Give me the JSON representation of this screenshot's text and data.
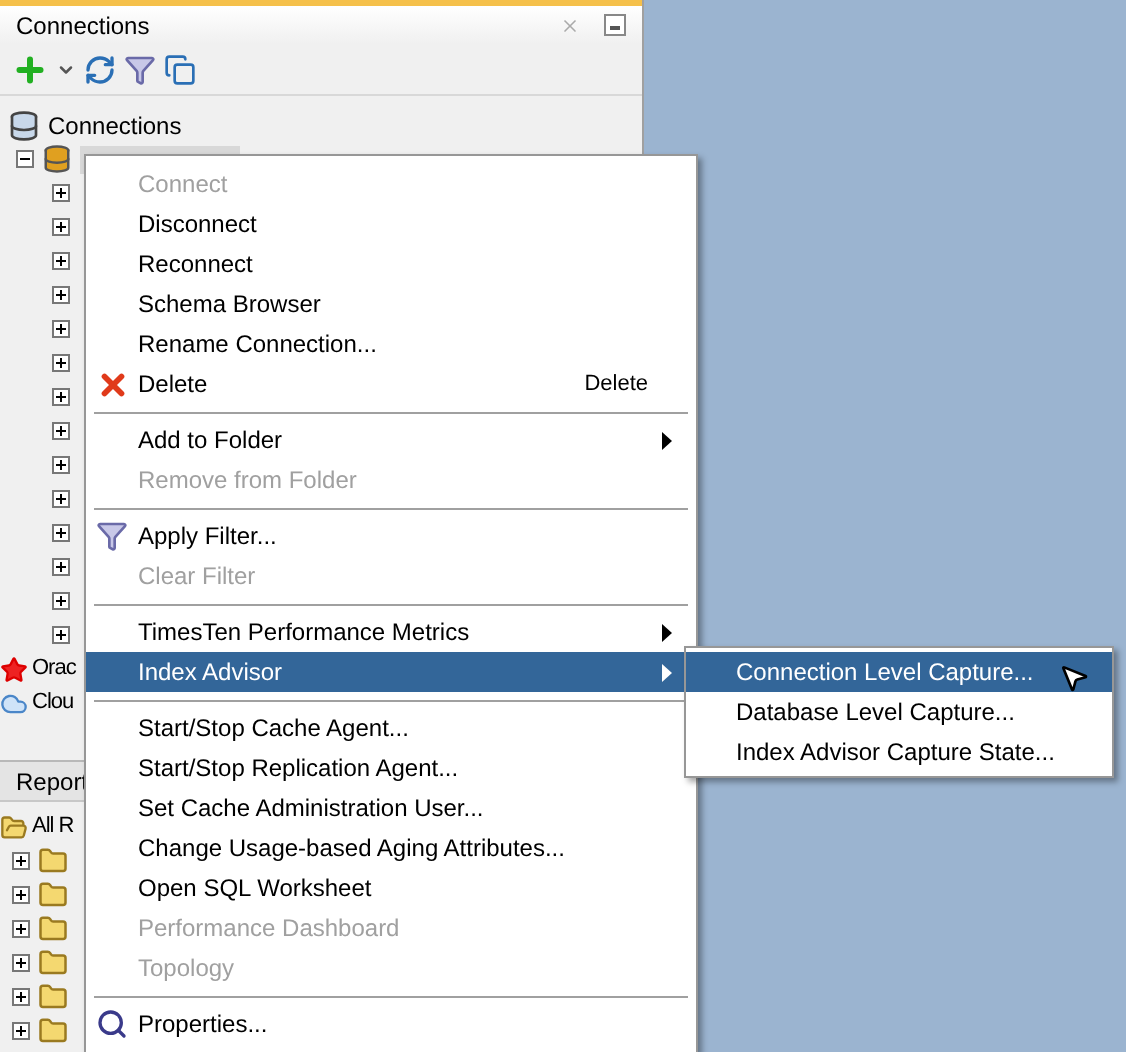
{
  "connections_panel": {
    "title": "Connections",
    "toolbar": [
      {
        "kind": "add"
      },
      {
        "kind": "dropdown"
      },
      {
        "kind": "refresh"
      },
      {
        "kind": "filter"
      },
      {
        "kind": "collapse"
      }
    ]
  },
  "tree": {
    "root": "Connections",
    "connection": {
      "expanded": true,
      "selected": true
    },
    "nodes": [
      {
        "expanded": false
      },
      {
        "expanded": false
      },
      {
        "expanded": false
      },
      {
        "expanded": false
      },
      {
        "expanded": false
      },
      {
        "expanded": false
      },
      {
        "expanded": false
      },
      {
        "expanded": false
      },
      {
        "expanded": false
      },
      {
        "expanded": false
      },
      {
        "expanded": false
      },
      {
        "expanded": false
      },
      {
        "expanded": false
      },
      {
        "expanded": false
      }
    ],
    "other_roots": [
      {
        "label": "Orac",
        "kind": "oracle"
      },
      {
        "label": "Clou",
        "kind": "cloud"
      }
    ]
  },
  "reports_panel": {
    "title": "Report",
    "root": "All R",
    "folders": [
      {
        "expanded": false
      },
      {
        "expanded": false
      },
      {
        "expanded": false
      },
      {
        "expanded": false
      },
      {
        "expanded": false
      },
      {
        "expanded": false
      }
    ]
  },
  "context_menu": [
    {
      "kind": "item",
      "label": "Connect",
      "disabled": true,
      "selected": false
    },
    {
      "kind": "item",
      "label": "Disconnect",
      "disabled": false,
      "selected": false
    },
    {
      "kind": "item",
      "label": "Reconnect",
      "disabled": false,
      "selected": false
    },
    {
      "kind": "item",
      "label": "Schema Browser",
      "disabled": false,
      "selected": false
    },
    {
      "kind": "item",
      "label": "Rename Connection...",
      "disabled": false,
      "selected": false
    },
    {
      "kind": "delete",
      "label": "Delete",
      "disabled": false,
      "selected": false,
      "shortcut": "Delete"
    },
    {
      "kind": "separator"
    },
    {
      "kind": "item",
      "label": "Add to Folder",
      "disabled": false,
      "selected": false,
      "submenu": true
    },
    {
      "kind": "item",
      "label": "Remove from Folder",
      "disabled": true,
      "selected": false
    },
    {
      "kind": "separator"
    },
    {
      "kind": "filter",
      "label": "Apply Filter...",
      "disabled": false,
      "selected": false
    },
    {
      "kind": "item",
      "label": "Clear Filter",
      "disabled": true,
      "selected": false
    },
    {
      "kind": "separator"
    },
    {
      "kind": "item",
      "label": "TimesTen Performance Metrics",
      "disabled": false,
      "selected": false,
      "submenu": true
    },
    {
      "kind": "item",
      "label": "Index Advisor",
      "disabled": false,
      "selected": true,
      "submenu": true
    },
    {
      "kind": "separator"
    },
    {
      "kind": "item",
      "label": "Start/Stop Cache Agent...",
      "disabled": false,
      "selected": false
    },
    {
      "kind": "item",
      "label": "Start/Stop Replication Agent...",
      "disabled": false,
      "selected": false
    },
    {
      "kind": "item",
      "label": "Set Cache Administration User...",
      "disabled": false,
      "selected": false
    },
    {
      "kind": "item",
      "label": "Change Usage-based Aging Attributes...",
      "disabled": false,
      "selected": false
    },
    {
      "kind": "item",
      "label": "Open SQL Worksheet",
      "disabled": false,
      "selected": false
    },
    {
      "kind": "item",
      "label": "Performance Dashboard",
      "disabled": true,
      "selected": false
    },
    {
      "kind": "item",
      "label": "Topology",
      "disabled": true,
      "selected": false
    },
    {
      "kind": "separator"
    },
    {
      "kind": "properties",
      "label": "Properties...",
      "disabled": false,
      "selected": false
    }
  ],
  "submenu": [
    {
      "label": "Connection Level Capture...",
      "selected": true
    },
    {
      "label": "Database Level Capture...",
      "selected": false
    },
    {
      "label": "Index Advisor Capture State...",
      "selected": false
    }
  ]
}
